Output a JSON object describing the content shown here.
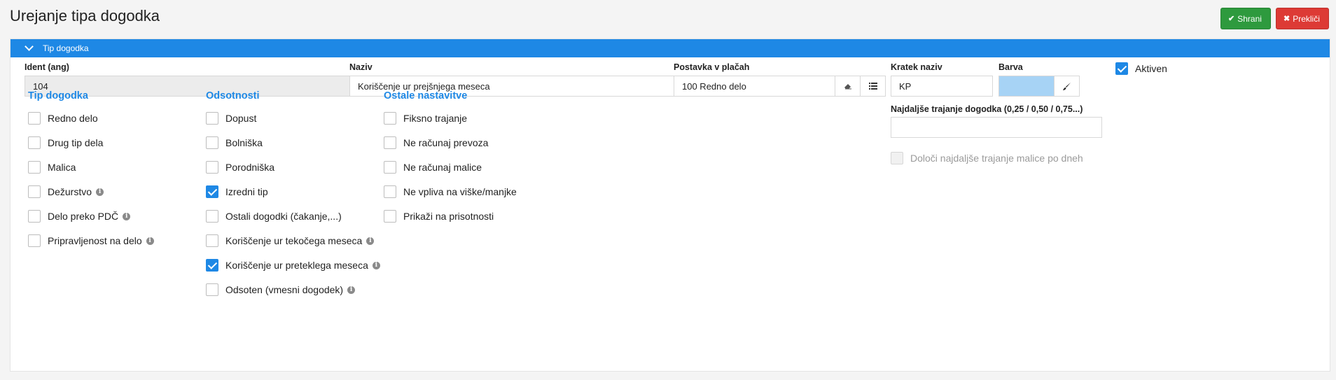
{
  "title": "Urejanje tipa dogodka",
  "toolbar": {
    "save_label": "Shrani",
    "cancel_label": "Prekliči",
    "save_icon": "check-icon",
    "cancel_icon": "times-icon"
  },
  "panel": {
    "header": "Tip dogodka",
    "header_color": "#1e88e5"
  },
  "fields": {
    "ident": {
      "label": "Ident (ang)",
      "value": "104"
    },
    "naziv": {
      "label": "Naziv",
      "value": "Koriščenje ur prejšnjega meseca"
    },
    "postavka": {
      "label": "Postavka v plačah",
      "value": "100 Redno delo"
    },
    "kratek": {
      "label": "Kratek naziv",
      "value": "KP"
    },
    "barva": {
      "label": "Barva",
      "color": "#a7d3f5"
    },
    "najdaljse": {
      "label": "Najdaljše trajanje dogodka (0,25 / 0,50 / 0,75...)",
      "value": ""
    }
  },
  "aktiven": {
    "label": "Aktiven",
    "checked": true
  },
  "doloci": {
    "label": "Določi najdaljše trajanje malice po dneh",
    "checked": false,
    "disabled": true
  },
  "sections": {
    "tip": {
      "title": "Tip dogodka",
      "items": [
        {
          "label": "Redno delo",
          "checked": false,
          "info": false
        },
        {
          "label": "Drug tip dela",
          "checked": false,
          "info": false
        },
        {
          "label": "Malica",
          "checked": false,
          "info": false
        },
        {
          "label": "Dežurstvo",
          "checked": false,
          "info": true
        },
        {
          "label": "Delo preko PDČ",
          "checked": false,
          "info": true
        },
        {
          "label": "Pripravljenost na delo",
          "checked": false,
          "info": true
        }
      ]
    },
    "odsotnosti": {
      "title": "Odsotnosti",
      "items": [
        {
          "label": "Dopust",
          "checked": false,
          "info": false
        },
        {
          "label": "Bolniška",
          "checked": false,
          "info": false
        },
        {
          "label": "Porodniška",
          "checked": false,
          "info": false
        },
        {
          "label": "Izredni tip",
          "checked": true,
          "info": false
        },
        {
          "label": "Ostali dogodki (čakanje,...)",
          "checked": false,
          "info": false
        },
        {
          "label": "Koriščenje ur tekočega meseca",
          "checked": false,
          "info": true
        },
        {
          "label": "Koriščenje ur preteklega meseca",
          "checked": true,
          "info": true
        },
        {
          "label": "Odsoten (vmesni dogodek)",
          "checked": false,
          "info": true
        }
      ]
    },
    "ostale": {
      "title": "Ostale nastavitve",
      "items": [
        {
          "label": "Fiksno trajanje",
          "checked": false,
          "info": false
        },
        {
          "label": "Ne računaj prevoza",
          "checked": false,
          "info": false
        },
        {
          "label": "Ne računaj malice",
          "checked": false,
          "info": false
        },
        {
          "label": "Ne vpliva na viške/manjke",
          "checked": false,
          "info": false
        },
        {
          "label": "Prikaži na prisotnosti",
          "checked": false,
          "info": false
        }
      ]
    }
  }
}
